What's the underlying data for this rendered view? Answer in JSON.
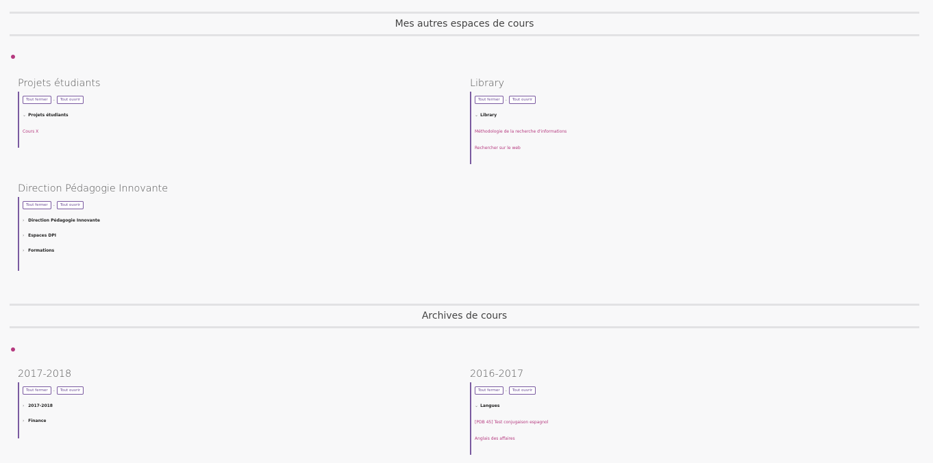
{
  "section_other": {
    "title": "Mes autres espaces de cours"
  },
  "section_archives": {
    "title": "Archives de cours"
  },
  "controls": {
    "close_all": "Tout fermer",
    "open_all": "Tout ouvrir",
    "separator": "-"
  },
  "blocks": {
    "projets": {
      "title": "Projets étudiants",
      "node": "Projets étudiants",
      "links": [
        "Cours X"
      ]
    },
    "library": {
      "title": "Library",
      "node": "Library",
      "links": [
        "Méthodologie de la recherche d'informations",
        "Rechercher sur le web"
      ]
    },
    "dpi": {
      "title": "Direction Pédagogie Innovante",
      "nodes": [
        "Direction Pédagogie Innovante",
        "Espaces DPI",
        "Formations"
      ]
    },
    "y2017": {
      "title": "2017-2018",
      "nodes": [
        "2017-2018",
        "Finance"
      ]
    },
    "y2016": {
      "title": "2016-2017",
      "node": "Langues",
      "links": [
        "[PDB 45] Test conjugaison espagnol",
        "Anglais des affaires"
      ]
    }
  },
  "colors": {
    "accent": "#b5397f",
    "border": "#7a5aa0",
    "rule": "#e2e2e4"
  }
}
